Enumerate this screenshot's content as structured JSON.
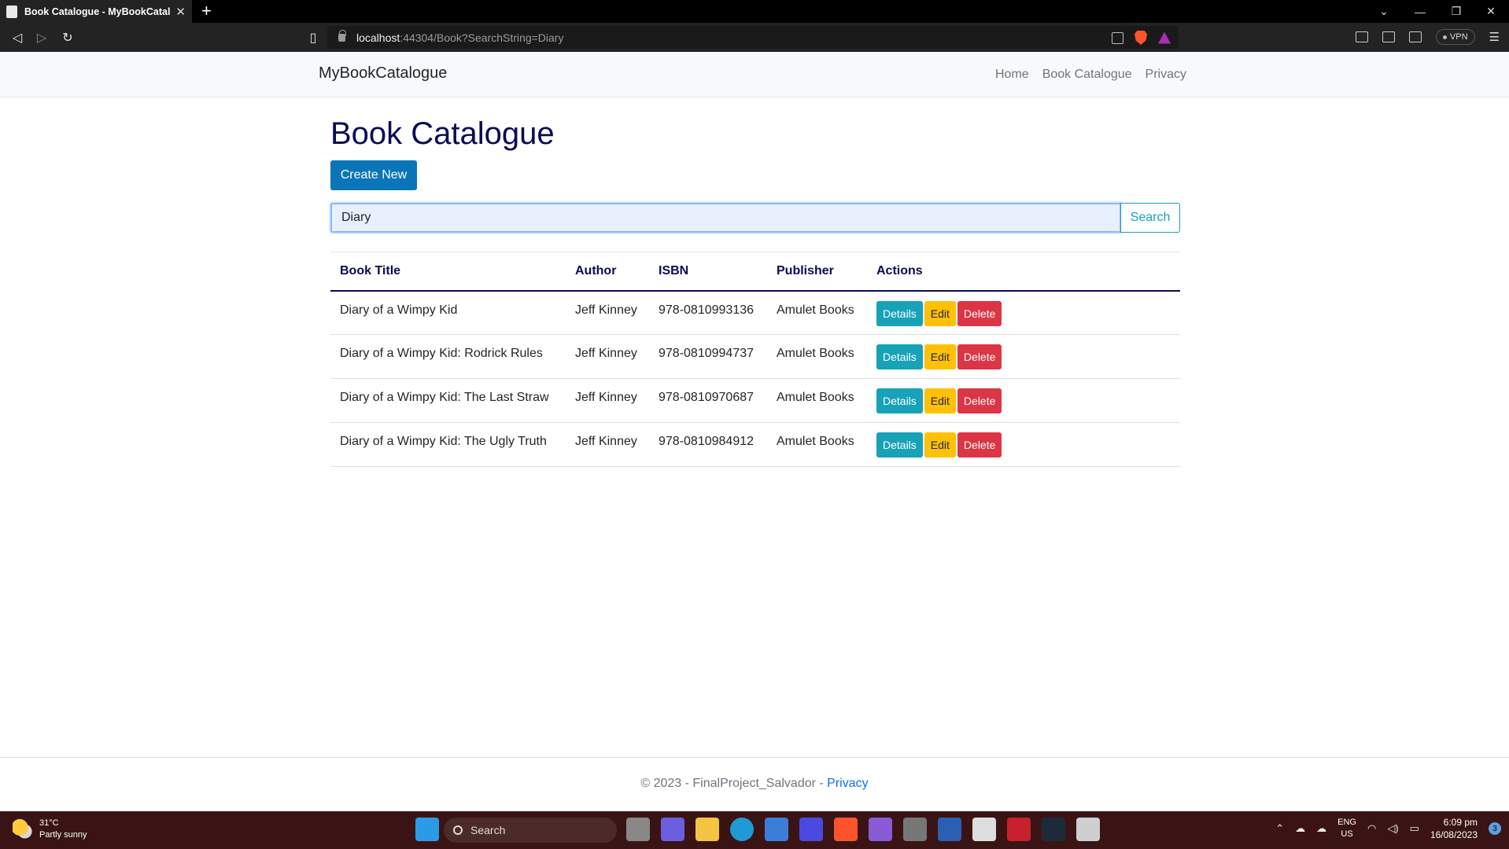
{
  "browser": {
    "tab_title": "Book Catalogue - MyBookCatalog",
    "tab_close": "✕",
    "new_tab": "+",
    "url_host": "localhost",
    "url_path": ":44304/Book?SearchString=Diary",
    "vpn_label": "VPN",
    "win_min": "—",
    "win_restore": "❐",
    "win_close": "✕",
    "chevron": "⌄"
  },
  "nav": {
    "brand": "MyBookCatalogue",
    "links": [
      "Home",
      "Book Catalogue",
      "Privacy"
    ]
  },
  "page": {
    "title": "Book Catalogue",
    "create_label": "Create New",
    "search_value": "Diary",
    "search_label": "Search"
  },
  "table": {
    "headers": [
      "Book Title",
      "Author",
      "ISBN",
      "Publisher",
      "Actions"
    ],
    "rows": [
      {
        "title": "Diary of a Wimpy Kid",
        "author": "Jeff Kinney",
        "isbn": "978-0810993136",
        "publisher": "Amulet Books"
      },
      {
        "title": "Diary of a Wimpy Kid: Rodrick Rules",
        "author": "Jeff Kinney",
        "isbn": "978-0810994737",
        "publisher": "Amulet Books"
      },
      {
        "title": "Diary of a Wimpy Kid: The Last Straw",
        "author": "Jeff Kinney",
        "isbn": "978-0810970687",
        "publisher": "Amulet Books"
      },
      {
        "title": "Diary of a Wimpy Kid: The Ugly Truth",
        "author": "Jeff Kinney",
        "isbn": "978-0810984912",
        "publisher": "Amulet Books"
      }
    ],
    "actions": {
      "details": "Details",
      "edit": "Edit",
      "delete": "Delete"
    }
  },
  "footer": {
    "text": "© 2023 - FinalProject_Salvador - ",
    "link": "Privacy"
  },
  "taskbar": {
    "temp": "31°C",
    "weather": "Partly sunny",
    "search": "Search",
    "lang_top": "ENG",
    "lang_bottom": "US",
    "time": "6:09 pm",
    "date": "16/08/2023",
    "notifications": "3"
  },
  "colors": {
    "heading": "#0a0a55",
    "primary": "#0a75b8",
    "info": "#17a2b8",
    "warning": "#ffc107",
    "danger": "#dc3545"
  }
}
